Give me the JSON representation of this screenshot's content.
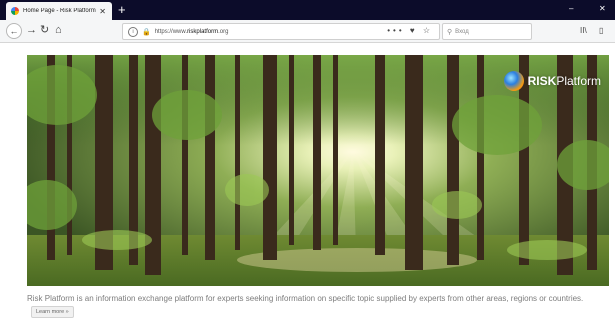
{
  "browser": {
    "tab": {
      "title": "Home Page - Risk Platform",
      "close": "✕"
    },
    "new_tab": "+",
    "window": {
      "minimize": "–",
      "close": "✕"
    },
    "url": {
      "prefix": "https://www.",
      "domain": "riskplatform",
      "suffix": ".org"
    },
    "url_actions": "••• ♥ ☆",
    "search_placeholder": "Вход",
    "search_icon": "search-icon",
    "right_icons": {
      "library": "II\\",
      "sidebar": "▯"
    }
  },
  "nav": {
    "back": "←",
    "forward": "→",
    "reload": "↻",
    "home": "⌂"
  },
  "hero": {
    "logo": {
      "bold": "RISK",
      "rest": "Platform"
    }
  },
  "content": {
    "description": "Risk Platform is an information exchange platform for experts seeking information on specific topic supplied by experts from other areas, regions or countries.",
    "learn_more": "Learn more »"
  },
  "colors": {
    "tabstrip": "#0c0c2a",
    "toolbar": "#f5f6f7",
    "description_text": "#7d7d7d"
  }
}
